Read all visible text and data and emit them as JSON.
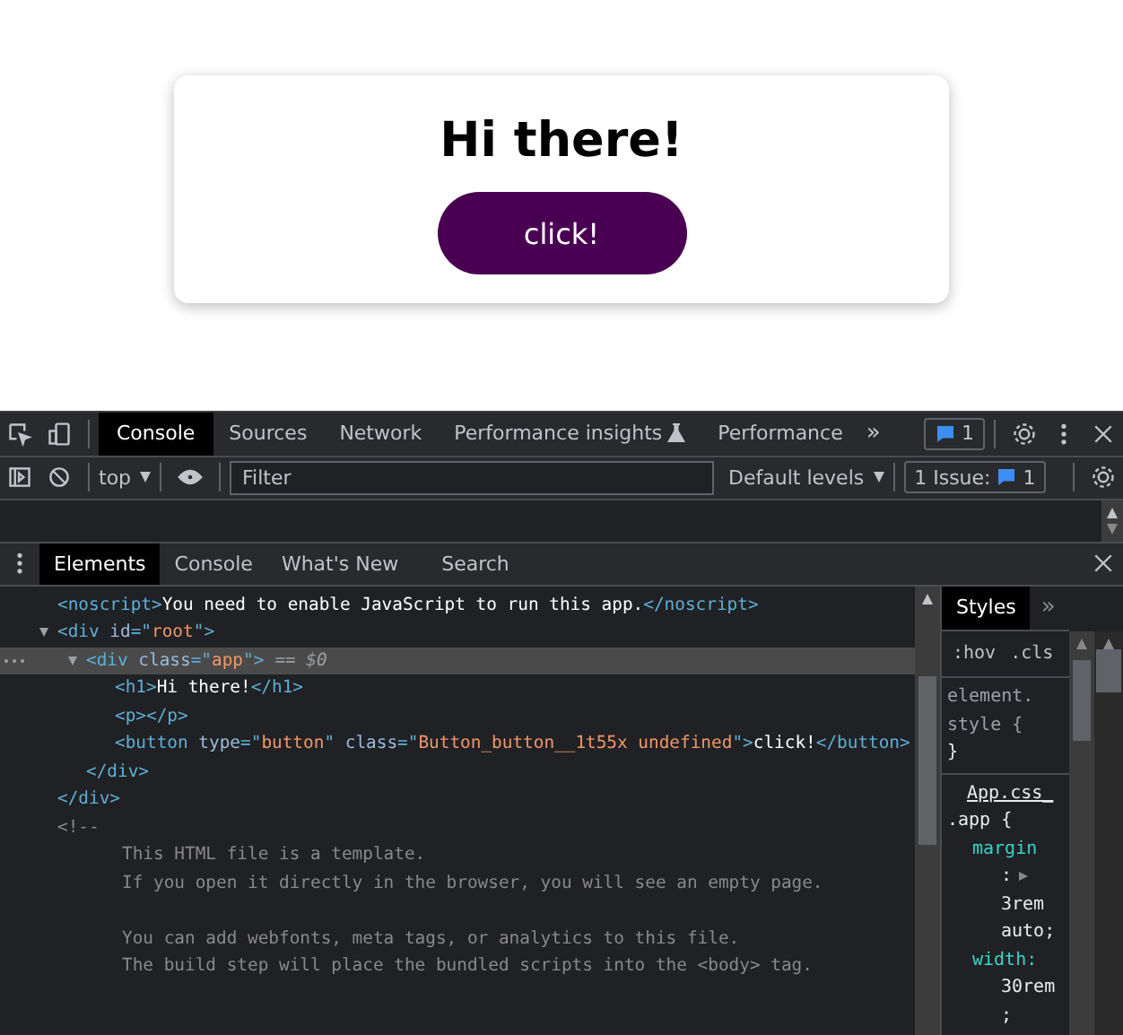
{
  "page": {
    "heading": "Hi there!",
    "button": "click!"
  },
  "devtools": {
    "main_tabs": [
      {
        "label": "Console",
        "selected": true,
        "kind": "plain"
      },
      {
        "label": "Sources",
        "selected": false,
        "kind": "plain"
      },
      {
        "label": "Network",
        "selected": false,
        "kind": "plain"
      },
      {
        "label": "Performance insights",
        "selected": false,
        "kind": "flask"
      },
      {
        "label": "Performance",
        "selected": false,
        "kind": "plain"
      }
    ],
    "more_tabs": "»",
    "messages_badge": "1",
    "console_toolbar": {
      "context": "top",
      "filter_placeholder": "Filter",
      "levels": "Default levels",
      "issues_label": "1 Issue:",
      "issues_count": "1"
    },
    "drawer_tabs": [
      {
        "label": "Elements",
        "selected": true
      },
      {
        "label": "Console",
        "selected": false
      },
      {
        "label": "What's New",
        "selected": false
      },
      {
        "label": "Search",
        "selected": false
      }
    ],
    "dom_tree": [
      {
        "tokens": [
          {
            "kind": "tag",
            "text": "<noscript>"
          },
          {
            "kind": "text",
            "text": "You need to enable JavaScript to run this app."
          },
          {
            "kind": "tag",
            "text": "</noscript>"
          }
        ]
      },
      {
        "tokens": [
          {
            "kind": "tag",
            "text": "<div "
          },
          {
            "kind": "attr",
            "text": "id"
          },
          {
            "kind": "tag",
            "text": "=\""
          },
          {
            "kind": "value",
            "text": "root"
          },
          {
            "kind": "tag",
            "text": "\">"
          }
        ],
        "expanded": true,
        "selected": false,
        "children": [
          {
            "tokens": [
              {
                "kind": "tag",
                "text": "<div "
              },
              {
                "kind": "attr",
                "text": "class"
              },
              {
                "kind": "tag",
                "text": "=\""
              },
              {
                "kind": "value",
                "text": "app"
              },
              {
                "kind": "tag",
                "text": "\">"
              }
            ],
            "marker": "== $0",
            "expanded": true,
            "selected": true,
            "children": [
              {
                "tokens": [
                  {
                    "kind": "tag",
                    "text": "<h1>"
                  },
                  {
                    "kind": "text",
                    "text": "Hi there!"
                  },
                  {
                    "kind": "tag",
                    "text": "</h1>"
                  }
                ]
              },
              {
                "tokens": [
                  {
                    "kind": "tag",
                    "text": "<p></p>"
                  }
                ]
              },
              {
                "tokens": [
                  {
                    "kind": "tag",
                    "text": "<button "
                  },
                  {
                    "kind": "attr",
                    "text": "type"
                  },
                  {
                    "kind": "tag",
                    "text": "=\""
                  },
                  {
                    "kind": "value",
                    "text": "button"
                  },
                  {
                    "kind": "tag",
                    "text": "\" "
                  },
                  {
                    "kind": "attr",
                    "text": "class"
                  },
                  {
                    "kind": "tag",
                    "text": "=\""
                  },
                  {
                    "kind": "value",
                    "text": "Button_button__1t55x undefined"
                  },
                  {
                    "kind": "tag",
                    "text": "\">"
                  },
                  {
                    "kind": "text",
                    "text": "click!"
                  },
                  {
                    "kind": "tag",
                    "text": "</button>"
                  }
                ]
              }
            ],
            "closing": "</div>"
          }
        ],
        "closing": "</div>"
      }
    ],
    "comment": {
      "open": "<!--",
      "paragraphs": [
        [
          "This HTML file is a template.",
          "If you open it directly in the browser, you will see an empty page."
        ],
        [
          "You can add webfonts, meta tags, or analytics to this file.",
          "The build step will place the bundled scripts into the <body> tag."
        ]
      ]
    },
    "styles": {
      "tabs": [
        {
          "label": "Styles",
          "selected": true
        }
      ],
      "more": "»",
      "filters": [
        ":hov",
        ".cls"
      ],
      "element_style": [
        "element.",
        "style {",
        "}"
      ],
      "source_link": "App.css_",
      "selector": ".app {",
      "props": [
        {
          "name": "margin",
          "sep": ":",
          "values": [
            "3rem",
            "auto;"
          ]
        },
        {
          "name": "width:",
          "values": [
            "30rem",
            ";"
          ]
        }
      ]
    }
  }
}
